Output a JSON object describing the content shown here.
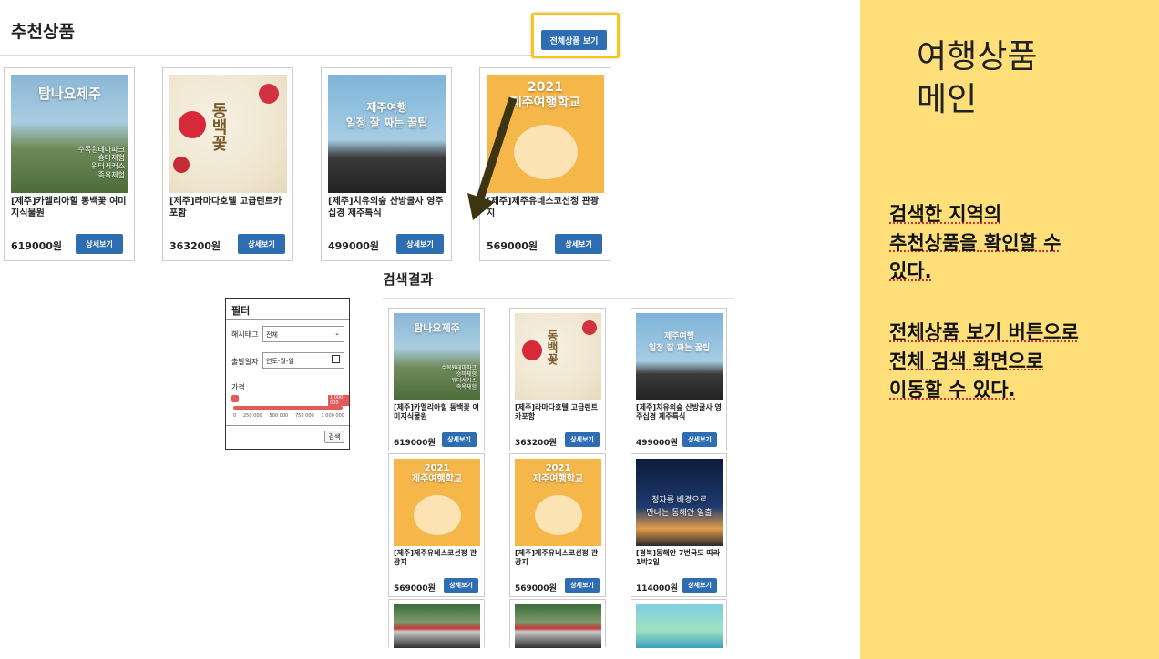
{
  "recommend": {
    "title": "추천상품",
    "view_all_label": "전체상품 보기",
    "products": [
      {
        "name": "[제주]카멜리아힐 동백꽃 여미지식물원",
        "price": "619000원",
        "detail_label": "상세보기",
        "thumb_title": "탐나요제주",
        "thumb_sub": "수목원테마파크\n승마체험\n워터서커스\n족욕체험"
      },
      {
        "name": "[제주]라마다호텔 고급렌트카포함",
        "price": "363200원",
        "detail_label": "상세보기",
        "thumb_title": "동백꽃",
        "thumb_sub": ""
      },
      {
        "name": "[제주]치유의숲 산방굴사 영주십경 제주특식",
        "price": "499000원",
        "detail_label": "상세보기",
        "thumb_title": "제주여행\n일정 잘 짜는 꿀팁",
        "thumb_sub": ""
      },
      {
        "name": "[제주]제주유네스코선정 관광지",
        "price": "569000원",
        "detail_label": "상세보기",
        "thumb_title": "2021\n제주여행학교",
        "thumb_sub": ""
      }
    ]
  },
  "results": {
    "title": "검색결과",
    "products": [
      {
        "name": "[제주]카멜리아힐 동백꽃 여미지식물원",
        "price": "619000원",
        "detail_label": "상세보기",
        "thumb_title": "탐나요제주",
        "thumb_sub": "수목원테마파크\n승마체험\n워터서커스\n족욕체험"
      },
      {
        "name": "[제주]라마다호텔 고급렌트카포함",
        "price": "363200원",
        "detail_label": "상세보기",
        "thumb_title": "동백꽃",
        "thumb_sub": ""
      },
      {
        "name": "[제주]치유의숲 산방굴사 영주십경 제주특식",
        "price": "499000원",
        "detail_label": "상세보기",
        "thumb_title": "제주여행\n일정 잘 짜는 꿀팁",
        "thumb_sub": ""
      },
      {
        "name": "[제주]제주유네스코선정 관광지",
        "price": "569000원",
        "detail_label": "상세보기",
        "thumb_title": "2021\n제주여행학교",
        "thumb_sub": ""
      },
      {
        "name": "[제주]제주유네스코선정 관광지",
        "price": "569000원",
        "detail_label": "상세보기",
        "thumb_title": "2021\n제주여행학교",
        "thumb_sub": ""
      },
      {
        "name": "[경북]동해안 7번국도 따라 1박2일",
        "price": "114000원",
        "detail_label": "상세보기",
        "thumb_title": "정자를 배경으로\n만나는 동해안 일출",
        "thumb_sub": ""
      }
    ]
  },
  "filter": {
    "title": "필터",
    "hashtag_label": "해시태그",
    "hashtag_value": "전체",
    "date_label": "출발일자",
    "date_placeholder": "연도-월-일",
    "price_label": "가격",
    "price_min": "0",
    "price_max": "1 000 000",
    "ticks": [
      "0",
      "250 000",
      "500 000",
      "750 000",
      "1 000 000"
    ],
    "search_label": "검색"
  },
  "panel": {
    "title": "여행상품\n메인",
    "desc1": "검색한 지역의\n추천상품을 확인할 수\n있다.",
    "desc2": "전체상품 보기 버튼으로\n전체 검색 화면으로\n이동할 수 있다."
  }
}
